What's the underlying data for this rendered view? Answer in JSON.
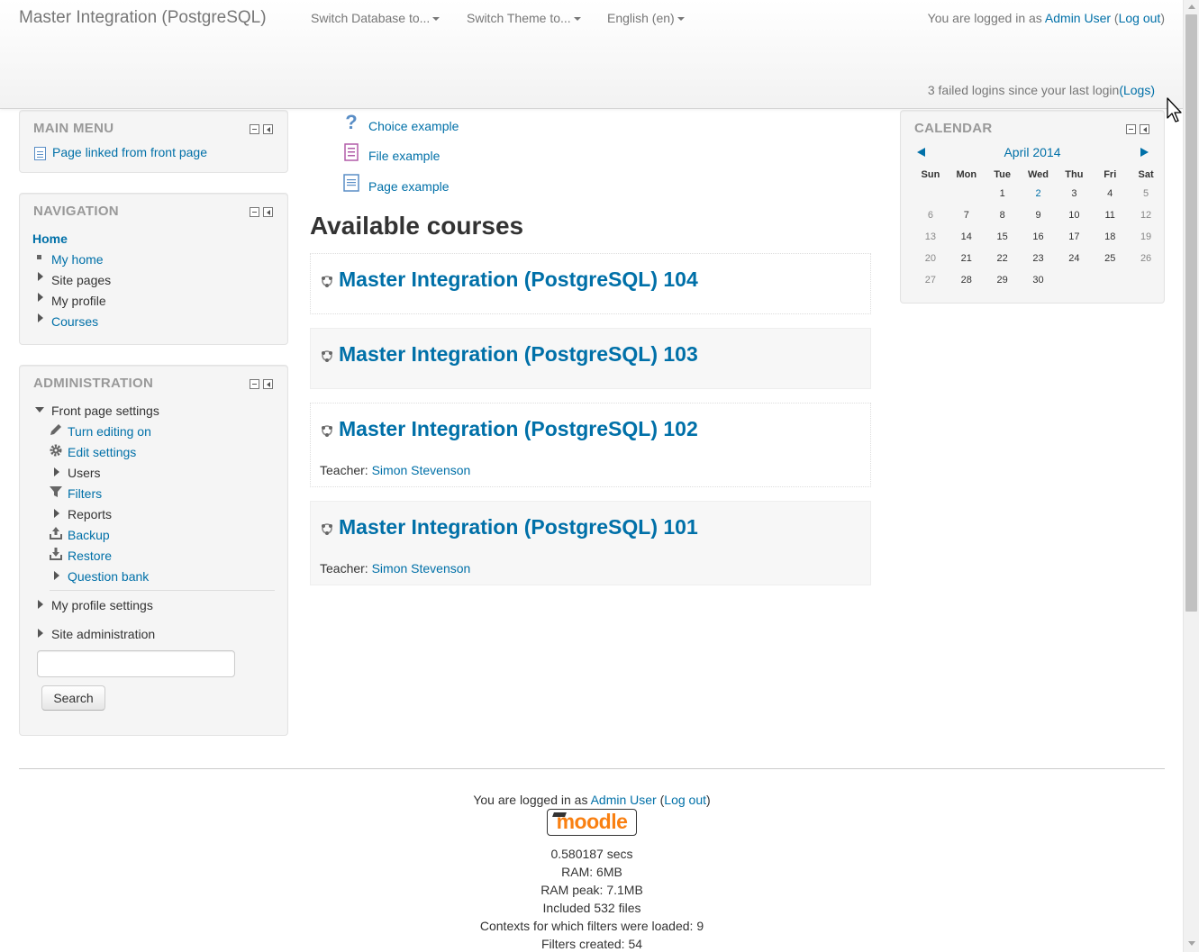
{
  "header": {
    "site_name": "Master Integration (PostgreSQL)",
    "menus": [
      "Switch Database to...",
      "Switch Theme to...",
      "English (en)"
    ],
    "login_prefix": "You are logged in as ",
    "user_name": "Admin User",
    "logout_label": "Log out",
    "failed_logins_text": "3 failed logins since your last login",
    "logs_label": "(Logs)"
  },
  "main_menu": {
    "title": "Main menu",
    "items": [
      {
        "label": "Page linked from front page",
        "icon": "page-icon"
      }
    ]
  },
  "navigation": {
    "title": "Navigation",
    "home": "Home",
    "items": [
      "My home",
      "Site pages",
      "My profile",
      "Courses"
    ]
  },
  "administration": {
    "title": "Administration",
    "front_page_settings": "Front page settings",
    "items": [
      {
        "label": "Turn editing on",
        "icon": "pencil-icon"
      },
      {
        "label": "Edit settings",
        "icon": "gear-icon"
      },
      {
        "label": "Users",
        "icon": "expand-arrow-icon"
      },
      {
        "label": "Filters",
        "icon": "filter-icon"
      },
      {
        "label": "Reports",
        "icon": "expand-arrow-icon"
      },
      {
        "label": "Backup",
        "icon": "backup-icon"
      },
      {
        "label": "Restore",
        "icon": "restore-icon"
      },
      {
        "label": "Question bank",
        "icon": "expand-arrow-icon"
      }
    ],
    "my_profile_settings": "My profile settings",
    "site_administration": "Site administration",
    "search_value": "",
    "search_button": "Search"
  },
  "activities": [
    {
      "label": "Choice example",
      "icon": "question-icon"
    },
    {
      "label": "File example",
      "icon": "file-icon"
    },
    {
      "label": "Page example",
      "icon": "page-icon"
    }
  ],
  "courses": {
    "heading": "Available courses",
    "teacher_label": "Teacher: ",
    "list": [
      {
        "name": "Master Integration (PostgreSQL) 104",
        "teacher": ""
      },
      {
        "name": "Master Integration (PostgreSQL) 103",
        "teacher": ""
      },
      {
        "name": "Master Integration (PostgreSQL) 102",
        "teacher": "Simon Stevenson"
      },
      {
        "name": "Master Integration (PostgreSQL) 101",
        "teacher": "Simon Stevenson"
      }
    ]
  },
  "calendar": {
    "title": "Calendar",
    "month": "April 2014",
    "weekdays": [
      "Sun",
      "Mon",
      "Tue",
      "Wed",
      "Thu",
      "Fri",
      "Sat"
    ],
    "weeks": [
      [
        "",
        "",
        "1",
        "2",
        "3",
        "4",
        "5"
      ],
      [
        "6",
        "7",
        "8",
        "9",
        "10",
        "11",
        "12"
      ],
      [
        "13",
        "14",
        "15",
        "16",
        "17",
        "18",
        "19"
      ],
      [
        "20",
        "21",
        "22",
        "23",
        "24",
        "25",
        "26"
      ],
      [
        "27",
        "28",
        "29",
        "30",
        "",
        "",
        ""
      ]
    ],
    "linked_days": [
      "2"
    ]
  },
  "footer": {
    "login_prefix": "You are logged in as ",
    "user_name": "Admin User",
    "logout_label": "Log out",
    "logo_text": "moodle",
    "stats": [
      "0.580187 secs",
      "RAM: 6MB",
      "RAM peak: 7.1MB",
      "Included 532 files",
      "Contexts for which filters were loaded: 9",
      "Filters created: 54"
    ]
  }
}
